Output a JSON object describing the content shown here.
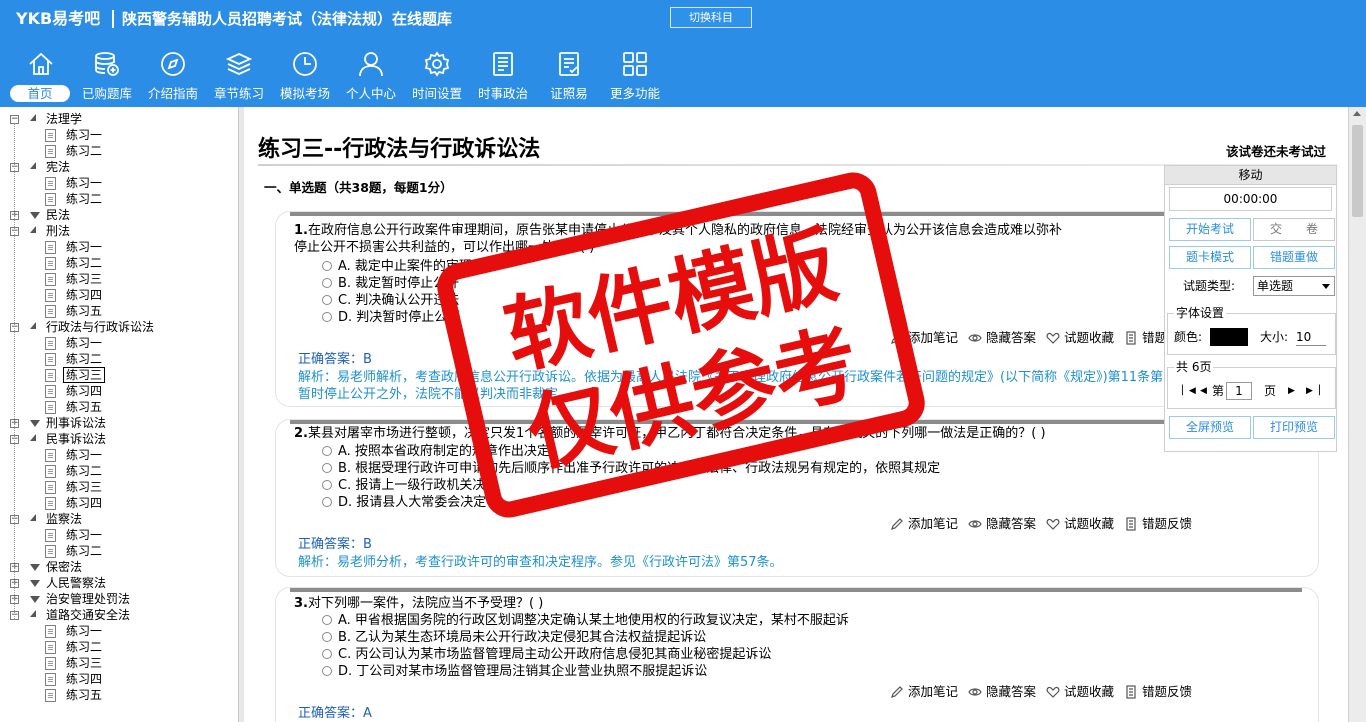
{
  "header": {
    "brand": "YKB易考吧",
    "title": "陕西警务辅助人员招聘考试（法律法规）在线题库",
    "switch_subject": "切换科目"
  },
  "nav": [
    {
      "label": "首页",
      "icon": "home-icon"
    },
    {
      "label": "已购题库",
      "icon": "database-icon"
    },
    {
      "label": "介绍指南",
      "icon": "compass-icon"
    },
    {
      "label": "章节练习",
      "icon": "layers-icon"
    },
    {
      "label": "模拟考场",
      "icon": "clock-icon"
    },
    {
      "label": "个人中心",
      "icon": "user-icon"
    },
    {
      "label": "时间设置",
      "icon": "gear-icon"
    },
    {
      "label": "时事政治",
      "icon": "newspaper-icon"
    },
    {
      "label": "证照易",
      "icon": "checklist-icon"
    },
    {
      "label": "更多功能",
      "icon": "grid-icon"
    }
  ],
  "tree": {
    "nodes": [
      {
        "label": "法理学",
        "type": "cat",
        "state": "open"
      },
      {
        "label": "练习一",
        "type": "leaf"
      },
      {
        "label": "练习二",
        "type": "leaf"
      },
      {
        "label": "宪法",
        "type": "cat",
        "state": "open"
      },
      {
        "label": "练习一",
        "type": "leaf"
      },
      {
        "label": "练习二",
        "type": "leaf"
      },
      {
        "label": "民法",
        "type": "cat",
        "state": "closed"
      },
      {
        "label": "刑法",
        "type": "cat",
        "state": "open"
      },
      {
        "label": "练习一",
        "type": "leaf"
      },
      {
        "label": "练习二",
        "type": "leaf"
      },
      {
        "label": "练习三",
        "type": "leaf"
      },
      {
        "label": "练习四",
        "type": "leaf"
      },
      {
        "label": "练习五",
        "type": "leaf"
      },
      {
        "label": "行政法与行政诉讼法",
        "type": "cat",
        "state": "open"
      },
      {
        "label": "练习一",
        "type": "leaf"
      },
      {
        "label": "练习二",
        "type": "leaf"
      },
      {
        "label": "练习三",
        "type": "leaf",
        "selected": true
      },
      {
        "label": "练习四",
        "type": "leaf"
      },
      {
        "label": "练习五",
        "type": "leaf"
      },
      {
        "label": "刑事诉讼法",
        "type": "cat",
        "state": "closed"
      },
      {
        "label": "民事诉讼法",
        "type": "cat",
        "state": "open"
      },
      {
        "label": "练习一",
        "type": "leaf"
      },
      {
        "label": "练习二",
        "type": "leaf"
      },
      {
        "label": "练习三",
        "type": "leaf"
      },
      {
        "label": "练习四",
        "type": "leaf"
      },
      {
        "label": "监察法",
        "type": "cat",
        "state": "open"
      },
      {
        "label": "练习一",
        "type": "leaf"
      },
      {
        "label": "练习二",
        "type": "leaf"
      },
      {
        "label": "保密法",
        "type": "cat",
        "state": "closed"
      },
      {
        "label": "人民警察法",
        "type": "cat",
        "state": "closed"
      },
      {
        "label": "治安管理处罚法",
        "type": "cat",
        "state": "closed"
      },
      {
        "label": "道路交通安全法",
        "type": "cat",
        "state": "open"
      },
      {
        "label": "练习一",
        "type": "leaf"
      },
      {
        "label": "练习二",
        "type": "leaf"
      },
      {
        "label": "练习三",
        "type": "leaf"
      },
      {
        "label": "练习四",
        "type": "leaf"
      },
      {
        "label": "练习五",
        "type": "leaf"
      }
    ]
  },
  "main": {
    "exam_title": "练习三--行政法与行政诉讼法",
    "exam_status": "该试卷还未考试过",
    "section_heading": "一、单选题（共38题，每题1分）",
    "questions": [
      {
        "number": "1.",
        "lines": [
          "在政府信息公开行政案件审理期间，原告张某申请停止公开涉及其个人隐私的政府信息。法院经审查认为公开该信息会造成难以弥补",
          "停止公开不损害公共利益的，可以作出哪一处理？( )"
        ],
        "options": [
          "A. 裁定中止案件的审理",
          "B. 裁定暂时停止公开",
          "C. 判决确认公开违法",
          "D. 判决暂时停止公开"
        ],
        "answer": "正确答案：B",
        "analysis": "解析：易老师解析，考查政府信息公开行政诉讼。依据为最高人民法院《关于审理政府信息公开行政案件若干问题的规定》(以下简称《规定》)第11条第2款。值得注意的是，除暂时停止公开之外，法院不能以判决而非裁定。"
      },
      {
        "number": "2.",
        "lines": [
          "某县对屠宰市场进行整顿，决定只发1个名额的屠宰许可证，甲乙丙丁都符合决定条件，县有关机关的下列哪一做法是正确的？( )"
        ],
        "options": [
          "A. 按照本省政府制定的规章作出决定",
          "B. 根据受理行政许可申请的先后顺序作出准予行政许可的决定，法律、行政法规另有规定的，依照其规定",
          "C. 报请上一级行政机关决定",
          "D. 报请县人大常委会决定"
        ],
        "answer": "正确答案：B",
        "analysis": "解析：易老师分析，考查行政许可的审查和决定程序。参见《行政许可法》第57条。"
      },
      {
        "number": "3.",
        "lines": [
          "对下列哪一案件，法院应当不予受理？( )"
        ],
        "options": [
          "A. 甲省根据国务院的行政区划调整决定确认某土地使用权的行政复议决定，某村不服起诉",
          "B. 乙认为某生态环境局未公开行政决定侵犯其合法权益提起诉讼",
          "C. 丙公司认为某市场监督管理局主动公开政府信息侵犯其商业秘密提起诉讼",
          "D. 丁公司对某市场监督管理局注销其企业营业执照不服提起诉讼"
        ],
        "answer": "正确答案：A",
        "analysis": ""
      }
    ],
    "actions": {
      "note": "添加笔记",
      "hide": "隐藏答案",
      "favorite": "试题收藏",
      "report": "错题反馈"
    }
  },
  "panel": {
    "move": "移动",
    "timer": "00:00:00",
    "start": "开始考试",
    "submit": "交　　卷",
    "card_mode": "题卡模式",
    "redo_wrong": "错题重做",
    "type_label": "试题类型:",
    "type_value": "单选题",
    "font_legend": "字体设置",
    "color_label": "颜色:",
    "font_color": "#000000",
    "size_label": "大小:",
    "size_value": "10",
    "pages_legend": "共 6页",
    "page_prefix": "第",
    "page_value": "1",
    "page_suffix": "页",
    "fullscreen": "全屏预览",
    "print": "打印预览"
  },
  "watermark": {
    "line1": "软件模版",
    "line2": "仅供参考",
    "color": "#e60d0d"
  },
  "colors": {
    "header_bg": "#2b8de6",
    "answer": "#1d5fc0",
    "analysis": "#1d8fd8"
  }
}
